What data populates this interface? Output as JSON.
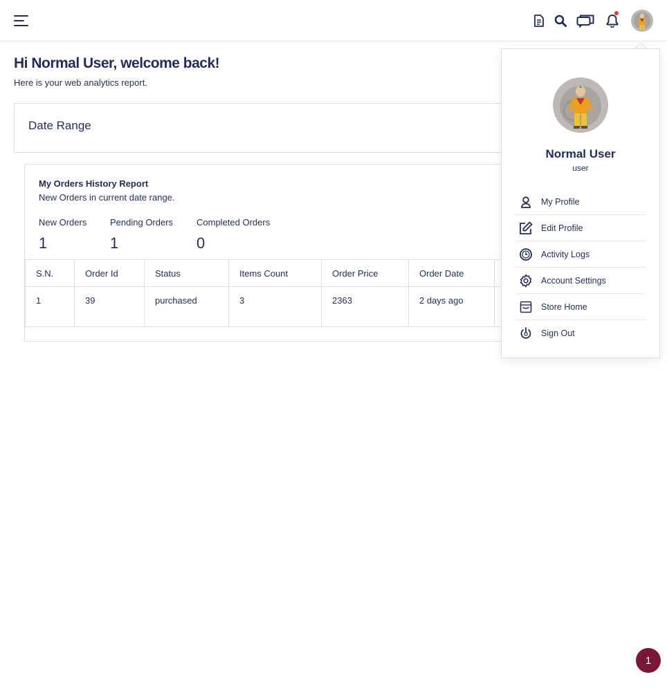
{
  "header": {
    "icons": [
      "menu-icon",
      "document-icon",
      "search-icon",
      "chat-icon",
      "bell-icon",
      "avatar"
    ],
    "notification_dot_color": "#e53935"
  },
  "welcome": {
    "title": "Hi Normal User, welcome back!",
    "subtitle": "Here is your web analytics report."
  },
  "date_range": {
    "title": "Date Range"
  },
  "orders": {
    "title": "My Orders History Report",
    "subtitle": "New Orders in current date range.",
    "stats": [
      {
        "label": "New Orders",
        "value": "1"
      },
      {
        "label": "Pending Orders",
        "value": "1"
      },
      {
        "label": "Completed Orders",
        "value": "0"
      }
    ],
    "columns": [
      "S.N.",
      "Order Id",
      "Status",
      "Items Count",
      "Order Price",
      "Order Date"
    ],
    "rows": [
      [
        "1",
        "39",
        "purchased",
        "3",
        "2363",
        "2 days ago"
      ]
    ]
  },
  "profile_menu": {
    "name": "Normal User",
    "role": "user",
    "items": [
      {
        "label": "My Profile",
        "icon": "user-icon"
      },
      {
        "label": "Edit Profile",
        "icon": "edit-icon"
      },
      {
        "label": "Activity Logs",
        "icon": "clock-icon"
      },
      {
        "label": "Account Settings",
        "icon": "gear-icon"
      },
      {
        "label": "Store Home",
        "icon": "store-icon"
      },
      {
        "label": "Sign Out",
        "icon": "power-icon"
      }
    ]
  },
  "floating_badge": {
    "label": "1",
    "color": "#7b1736"
  }
}
